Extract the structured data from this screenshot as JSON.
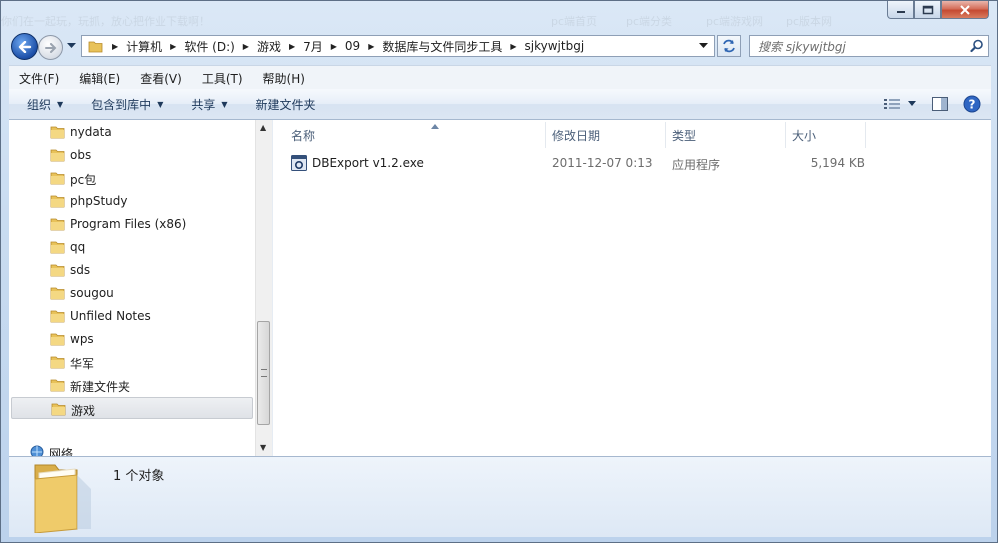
{
  "window": {
    "ghost_title_fragments": [
      "你们在一起玩，玩抓，放心把作业下载啊！",
      "pc端首页",
      "pc端分类",
      "pc端游戏网",
      "pc版本网"
    ]
  },
  "nav": {
    "breadcrumbs": [
      "计算机",
      "软件 (D:)",
      "游戏",
      "7月",
      "09",
      "数据库与文件同步工具",
      "sjkywjtbgj"
    ],
    "search_placeholder": "搜索 sjkywjtbgj"
  },
  "menu": [
    "文件(F)",
    "编辑(E)",
    "查看(V)",
    "工具(T)",
    "帮助(H)"
  ],
  "commands": {
    "organize": "组织",
    "include_in_library": "包含到库中",
    "share": "共享",
    "new_folder": "新建文件夹"
  },
  "tree": {
    "items": [
      "nydata",
      "obs",
      "pc包",
      "phpStudy",
      "Program Files (x86)",
      "qq",
      "sds",
      "sougou",
      "Unfiled Notes",
      "wps",
      "华军",
      "新建文件夹",
      "游戏"
    ],
    "selected": "游戏",
    "network": "网络"
  },
  "columns": {
    "name": "名称",
    "modified": "修改日期",
    "type": "类型",
    "size": "大小"
  },
  "files": [
    {
      "name": "DBExport v1.2.exe",
      "modified": "2011-12-07 0:13",
      "type": "应用程序",
      "size": "5,194 KB"
    }
  ],
  "details": {
    "count_text": "1 个对象"
  },
  "colors": {
    "folder_yellow": "#e8c25a",
    "accent_blue": "#1c4fa8",
    "close_red": "#c54a32"
  }
}
